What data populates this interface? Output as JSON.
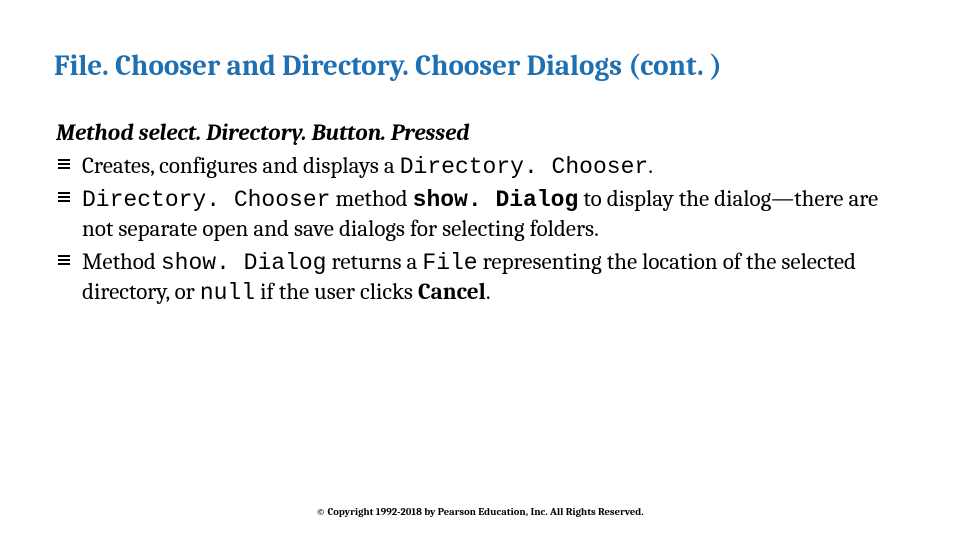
{
  "title": "File. Chooser and Directory. Chooser Dialogs (cont. )",
  "subheading": "Method select. Directory. Button. Pressed",
  "bullets": {
    "b0": {
      "t0": "Creates, configures and displays a ",
      "c0": "Directory. Chooser",
      "t1": ". "
    },
    "b1": {
      "c0": "Directory. Chooser",
      "t0": " method ",
      "c1": "show. Dialog",
      "t1": " to display the dialog—there are not separate open and save dialogs for selecting folders."
    },
    "b2": {
      "t0": "Method ",
      "c0": "show. Dialog",
      "t1": " returns a ",
      "c1": "File",
      "t2": " representing the location of the selected directory, or ",
      "c2": "null",
      "t3": " if the user clicks ",
      "b0": "Cancel",
      "t4": "."
    }
  },
  "copyright": "© Copyright 1992-2018 by Pearson Education, Inc. All Rights Reserved."
}
